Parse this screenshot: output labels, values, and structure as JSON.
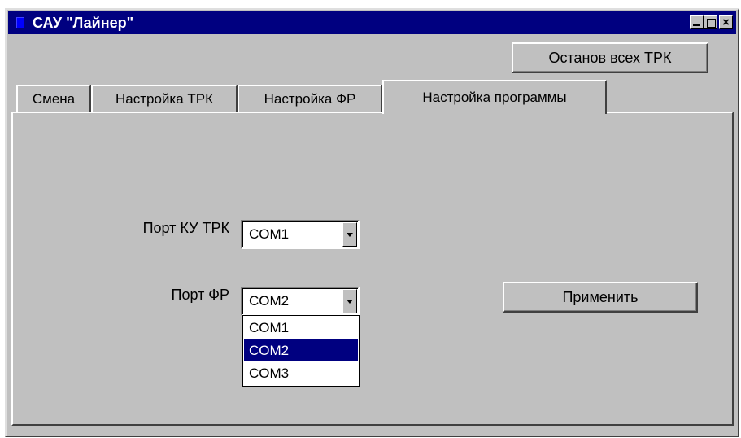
{
  "window": {
    "title": "САУ \"Лайнер\""
  },
  "toolbar": {
    "stop_all_label": "Останов всех ТРК"
  },
  "tabs": [
    {
      "label": "Смена"
    },
    {
      "label": "Настройка ТРК"
    },
    {
      "label": "Настройка ФР"
    },
    {
      "label": "Настройка программы"
    }
  ],
  "settings": {
    "port_ku_label": "Порт КУ ТРК",
    "port_ku_value": "COM1",
    "port_fr_label": "Порт ФР",
    "port_fr_value": "COM2",
    "port_fr_options": [
      "COM1",
      "COM2",
      "COM3"
    ],
    "apply_label": "Применить"
  },
  "colors": {
    "titlebar": "#000080",
    "face": "#c0c0c0",
    "selection": "#000080"
  },
  "icons": {
    "app": "app-icon",
    "minimize": "minimize-icon",
    "maximize": "maximize-icon",
    "close": "close-icon",
    "dropdown": "chevron-down-icon"
  }
}
